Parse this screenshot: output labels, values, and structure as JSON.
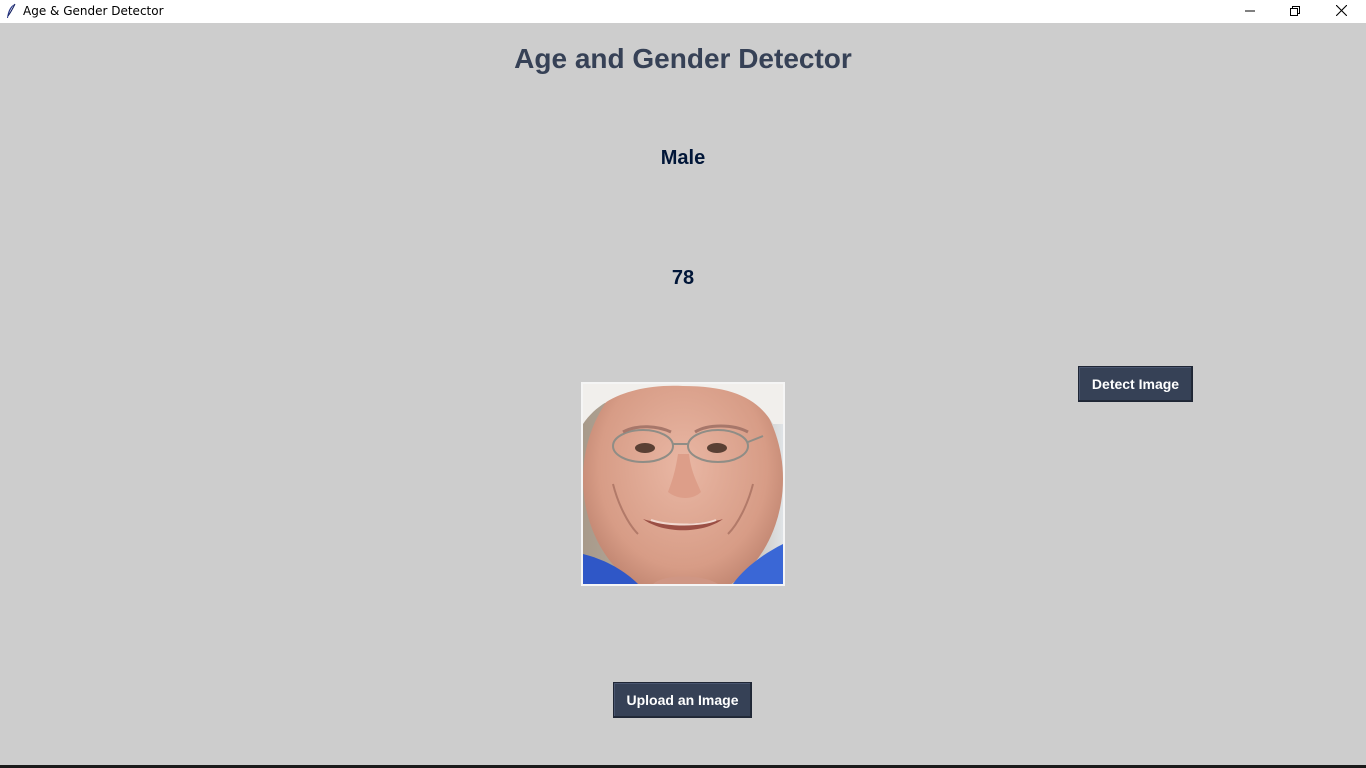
{
  "window": {
    "title": "Age & Gender Detector",
    "icon": "feather-icon",
    "controls": [
      "minimize-icon",
      "restore-icon",
      "close-icon"
    ]
  },
  "main": {
    "heading": "Age and Gender Detector",
    "gender": "Male",
    "age": "78"
  },
  "buttons": {
    "detect_label": "Detect Image",
    "upload_label": "Upload an Image"
  },
  "colors": {
    "background": "#cdcdcd",
    "heading": "#364156",
    "result_text": "#011638",
    "button_bg": "#364156",
    "button_text": "#ffffff"
  }
}
